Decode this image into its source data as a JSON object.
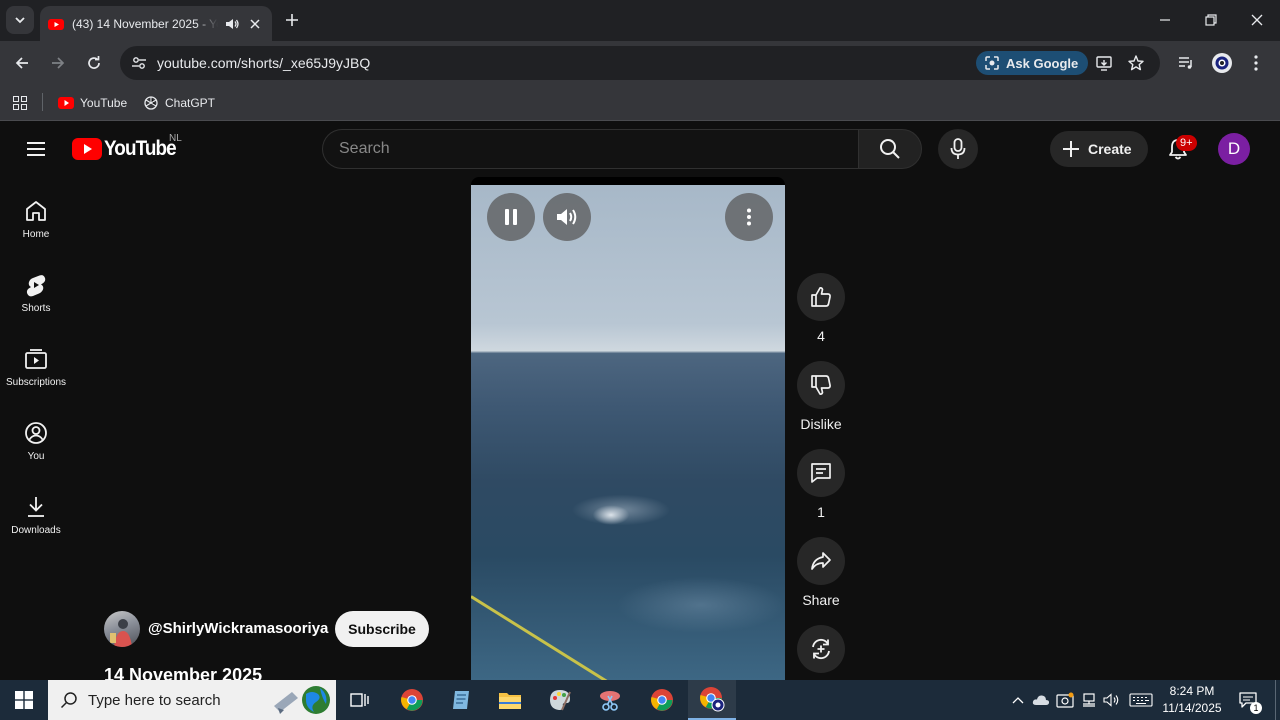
{
  "browser": {
    "tab": {
      "title": "(43) 14 November 2025 - YouTube"
    },
    "url": "youtube.com/shorts/_xe65J9yJBQ",
    "ask_google_label": "Ask Google",
    "bookmarks": [
      {
        "label": "YouTube"
      },
      {
        "label": "ChatGPT"
      }
    ]
  },
  "youtube": {
    "logo_text": "YouTube",
    "country_code": "NL",
    "search": {
      "placeholder": "Search"
    },
    "create_label": "Create",
    "notification_badge": "9+",
    "avatar_letter": "D",
    "accent_color": "#ff0000",
    "guide": [
      {
        "label": "Home",
        "icon": "home-icon"
      },
      {
        "label": "Shorts",
        "icon": "shorts-icon"
      },
      {
        "label": "Subscriptions",
        "icon": "subscriptions-icon"
      },
      {
        "label": "You",
        "icon": "you-icon"
      },
      {
        "label": "Downloads",
        "icon": "download-icon"
      }
    ],
    "short": {
      "channel_handle": "@ShirlyWickramasooriya",
      "subscribe_label": "Subscribe",
      "title": "14 November 2025",
      "like_count": "4",
      "dislike_label": "Dislike",
      "comment_count": "1",
      "share_label": "Share"
    }
  },
  "taskbar": {
    "search_placeholder": "Type here to search",
    "time": "8:24 PM",
    "date": "11/14/2025",
    "notification_count": "1"
  }
}
